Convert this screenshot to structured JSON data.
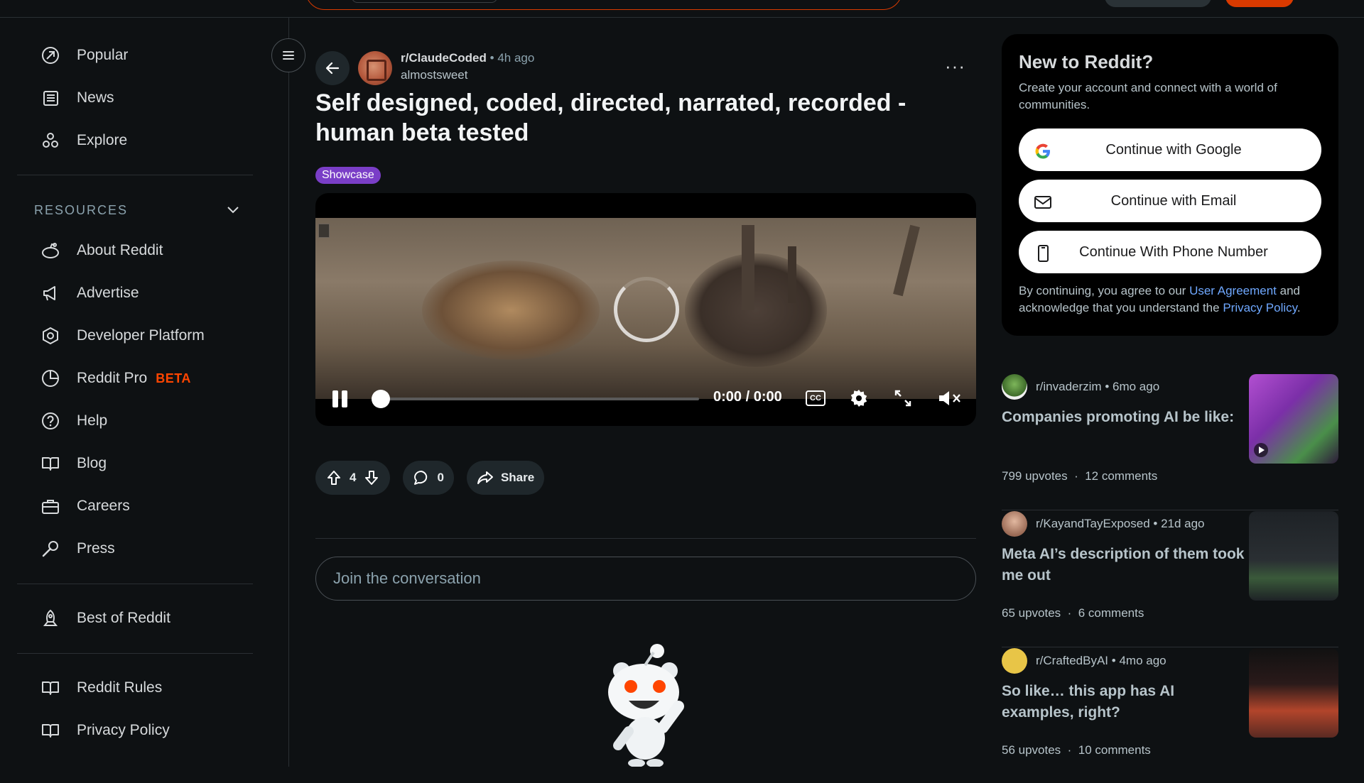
{
  "sidebar": {
    "items_top": [
      {
        "label": "Popular",
        "icon": "popular-icon"
      },
      {
        "label": "News",
        "icon": "news-icon"
      },
      {
        "label": "Explore",
        "icon": "explore-icon"
      }
    ],
    "resources_label": "RESOURCES",
    "resources": [
      {
        "label": "About Reddit",
        "icon": "reddit-alien-icon"
      },
      {
        "label": "Advertise",
        "icon": "megaphone-icon"
      },
      {
        "label": "Developer Platform",
        "icon": "developer-icon"
      },
      {
        "label": "Reddit Pro",
        "icon": "pie-chart-icon",
        "badge": "BETA"
      },
      {
        "label": "Help",
        "icon": "help-icon"
      },
      {
        "label": "Blog",
        "icon": "book-icon"
      },
      {
        "label": "Careers",
        "icon": "briefcase-icon"
      },
      {
        "label": "Press",
        "icon": "microphone-icon"
      }
    ],
    "best_of": {
      "label": "Best of Reddit",
      "icon": "rocket-icon"
    },
    "rules": [
      {
        "label": "Reddit Rules",
        "icon": "book-icon"
      },
      {
        "label": "Privacy Policy",
        "icon": "book-icon"
      }
    ]
  },
  "post": {
    "subreddit": "r/ClaudeCoded",
    "time": "4h ago",
    "author": "almostsweet",
    "title": "Self designed, coded, directed, narrated, recorded - human beta tested",
    "flair": "Showcase",
    "video": {
      "time": "0:00 / 0:00",
      "cc": "CC",
      "progress": 0
    },
    "votes": "4",
    "comments": "0",
    "share_label": "Share",
    "more_label": "···",
    "join_placeholder": "Join the conversation"
  },
  "signup": {
    "title": "New to Reddit?",
    "desc": "Create your account and connect with a world of communities.",
    "google": "Continue with Google",
    "email": "Continue with Email",
    "phone": "Continue With Phone Number",
    "fine_prefix": "By continuing, you agree to our",
    "user_agreement": "User Agreement",
    "fine_mid": "and acknowledge that you understand the",
    "privacy": "Privacy Policy",
    "fine_end": "."
  },
  "related": [
    {
      "sub": "r/invaderzim",
      "time": "6mo ago",
      "title": "Companies promoting AI be like:",
      "upvotes": "799 upvotes",
      "comments": "12 comments"
    },
    {
      "sub": "r/KayandTayExposed",
      "time": "21d ago",
      "title": "Meta AI’s description of them took me out",
      "upvotes": "65 upvotes",
      "comments": "6 comments"
    },
    {
      "sub": "r/CraftedByAI",
      "time": "4mo ago",
      "title": "So like… this app has AI examples, right?",
      "upvotes": "56 upvotes",
      "comments": "10 comments"
    }
  ],
  "colors": {
    "accent": "#d93a00",
    "flair": "#7a3ec7",
    "link": "#6fa8ff",
    "beta": "#ff4500"
  }
}
